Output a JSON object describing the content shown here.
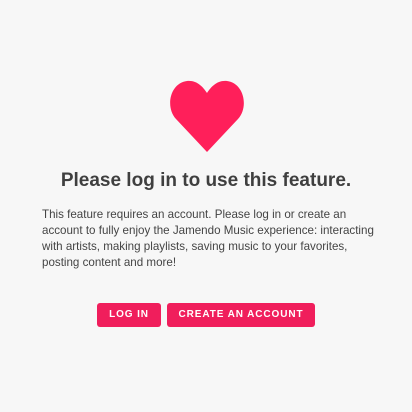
{
  "prompt": {
    "icon": "heart-icon",
    "icon_color": "#ff1f5a",
    "title": "Please log in to use this feature.",
    "description": "This feature requires an account. Please log in or create an account to fully enjoy the Jamendo Music experience: interacting with artists, making playlists, saving music to your favorites, posting content and more!"
  },
  "actions": {
    "login_label": "LOG IN",
    "create_account_label": "CREATE AN ACCOUNT",
    "button_color": "#f01e5c"
  }
}
